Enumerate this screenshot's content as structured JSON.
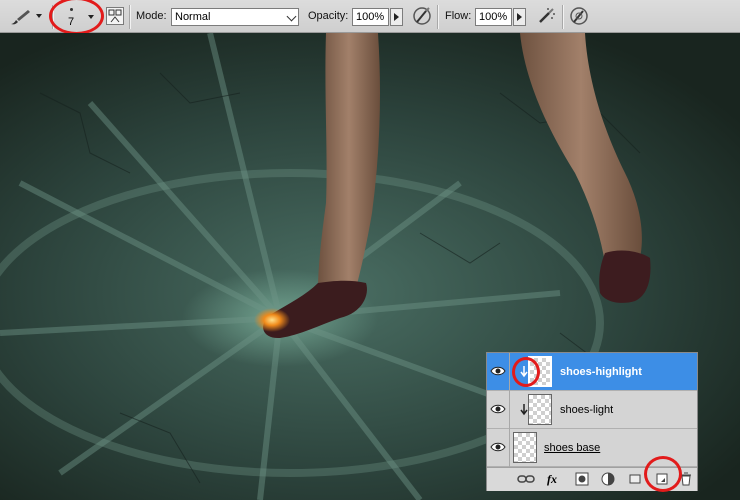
{
  "options_bar": {
    "tool_preset_icon": "brush-icon",
    "brush_size": "7",
    "mode_label": "Mode:",
    "mode_value": "Normal",
    "opacity_label": "Opacity:",
    "opacity_value": "100%",
    "flow_label": "Flow:",
    "flow_value": "100%",
    "icons": [
      "brush-panel-icon",
      "opacity-pressure-icon",
      "airbrush-icon",
      "size-pressure-icon"
    ]
  },
  "layers_panel": {
    "layers": [
      {
        "name": "shoes-highlight",
        "visible": true,
        "selected": true,
        "clipped": true
      },
      {
        "name": "shoes-light",
        "visible": true,
        "selected": false,
        "clipped": true
      },
      {
        "name": "shoes base",
        "visible": true,
        "selected": false,
        "clipped": false
      }
    ],
    "footer_icons": [
      "link-layers-icon",
      "fx-icon",
      "layer-mask-icon",
      "adjustment-layer-icon",
      "new-group-icon",
      "new-layer-icon",
      "trash-icon"
    ],
    "fx_label": "fx"
  },
  "annotations": {
    "highlight_color": "#e21b1b"
  },
  "colors": {
    "selection": "#3d8ee6"
  }
}
